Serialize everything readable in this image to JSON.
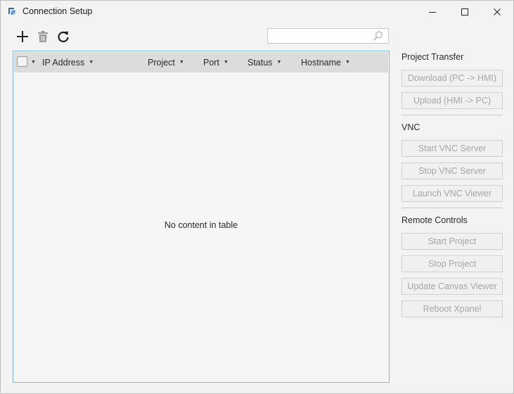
{
  "window": {
    "title": "Connection Setup"
  },
  "toolbar": {
    "add_icon": "plus-icon",
    "delete_icon": "trash-icon",
    "refresh_icon": "refresh-icon"
  },
  "search": {
    "value": "",
    "placeholder": "",
    "icon": "search-icon"
  },
  "table": {
    "columns": [
      "IP Address",
      "Project",
      "Port",
      "Status",
      "Hostname"
    ],
    "rows": [],
    "empty_message": "No content in table"
  },
  "sidebar": {
    "project_transfer": {
      "label": "Project Transfer",
      "buttons": [
        "Download (PC -> HMI)",
        "Upload (HMI -> PC)"
      ]
    },
    "vnc": {
      "label": "VNC",
      "buttons": [
        "Start VNC Server",
        "Stop VNC Server",
        "Launch VNC Viewer"
      ]
    },
    "remote_controls": {
      "label": "Remote Controls",
      "buttons": [
        "Start Project",
        "Stop Project",
        "Update Canvas Viewer",
        "Reboot Xpanel"
      ]
    }
  },
  "colors": {
    "table_border": "#7fb7d8",
    "header_bg": "#dcdcdc",
    "disabled_text": "#a6a6a6"
  }
}
